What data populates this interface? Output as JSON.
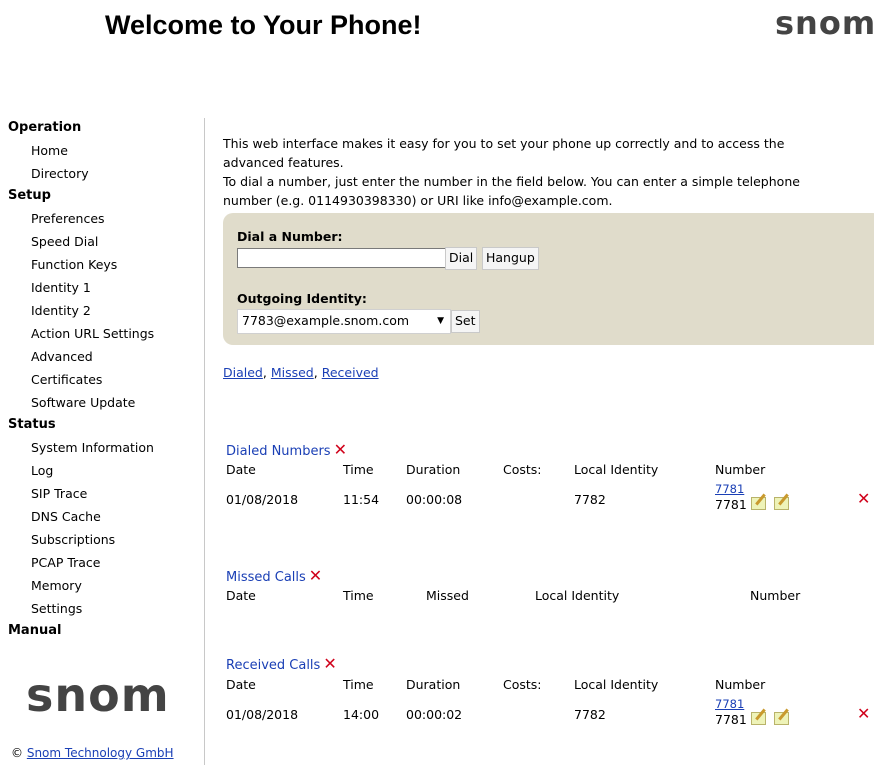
{
  "header": {
    "title": "Welcome to Your Phone!",
    "logo": "snom"
  },
  "sidebar": {
    "operation": "Operation",
    "home": "Home",
    "directory": "Directory",
    "setup": "Setup",
    "preferences": "Preferences",
    "speed_dial": "Speed Dial",
    "function_keys": "Function Keys",
    "identity1": "Identity 1",
    "identity2": "Identity 2",
    "action_url": "Action URL Settings",
    "advanced": "Advanced",
    "certificates": "Certificates",
    "software_update": "Software Update",
    "status": "Status",
    "system_information": "System Information",
    "log": "Log",
    "sip_trace": "SIP Trace",
    "dns_cache": "DNS Cache",
    "subscriptions": "Subscriptions",
    "pcap_trace": "PCAP Trace",
    "memory": "Memory",
    "settings": "Settings",
    "manual": "Manual",
    "logo": "snom"
  },
  "footer": {
    "copyright_symbol": "©",
    "company": "Snom Technology GmbH"
  },
  "intro": {
    "line1": "This web interface makes it easy for you to set your phone up correctly and to access the advanced features.",
    "line2": "To dial a number, just enter the number in the field below. You can enter a simple telephone number (e.g. 0114930398330) or URI like info@example.com."
  },
  "dial": {
    "label": "Dial a Number:",
    "input_value": "",
    "dial_button": "Dial",
    "hangup_button": "Hangup",
    "identity_label": "Outgoing Identity:",
    "identity_value": "7783@example.snom.com",
    "set_button": "Set"
  },
  "quick_links": {
    "dialed": "Dialed",
    "sep1": ",",
    "missed": "Missed",
    "sep2": ",",
    "received": "Received"
  },
  "dialed": {
    "title": "Dialed Numbers",
    "headers": {
      "date": "Date",
      "time": "Time",
      "duration": "Duration",
      "costs": "Costs:",
      "local_identity": "Local Identity",
      "number": "Number"
    },
    "row": {
      "date": "01/08/2018",
      "time": "11:54",
      "duration": "00:00:08",
      "local_identity": "7782",
      "number_link": "7781",
      "number_text": "7781"
    }
  },
  "missed": {
    "title": "Missed Calls",
    "headers": {
      "date": "Date",
      "time": "Time",
      "missed": "Missed",
      "local_identity": "Local Identity",
      "number": "Number"
    }
  },
  "received": {
    "title": "Received Calls",
    "headers": {
      "date": "Date",
      "time": "Time",
      "duration": "Duration",
      "costs": "Costs:",
      "local_identity": "Local Identity",
      "number": "Number"
    },
    "row": {
      "date": "01/08/2018",
      "time": "14:00",
      "duration": "00:00:02",
      "local_identity": "7782",
      "number_link": "7781",
      "number_text": "7781"
    }
  },
  "icons": {
    "delete": "red-x-icon",
    "edit": "edit-pencil-icon"
  },
  "colors": {
    "link": "#1a3fb5",
    "delete": "#d0021b",
    "panel": "#e0dccb"
  }
}
